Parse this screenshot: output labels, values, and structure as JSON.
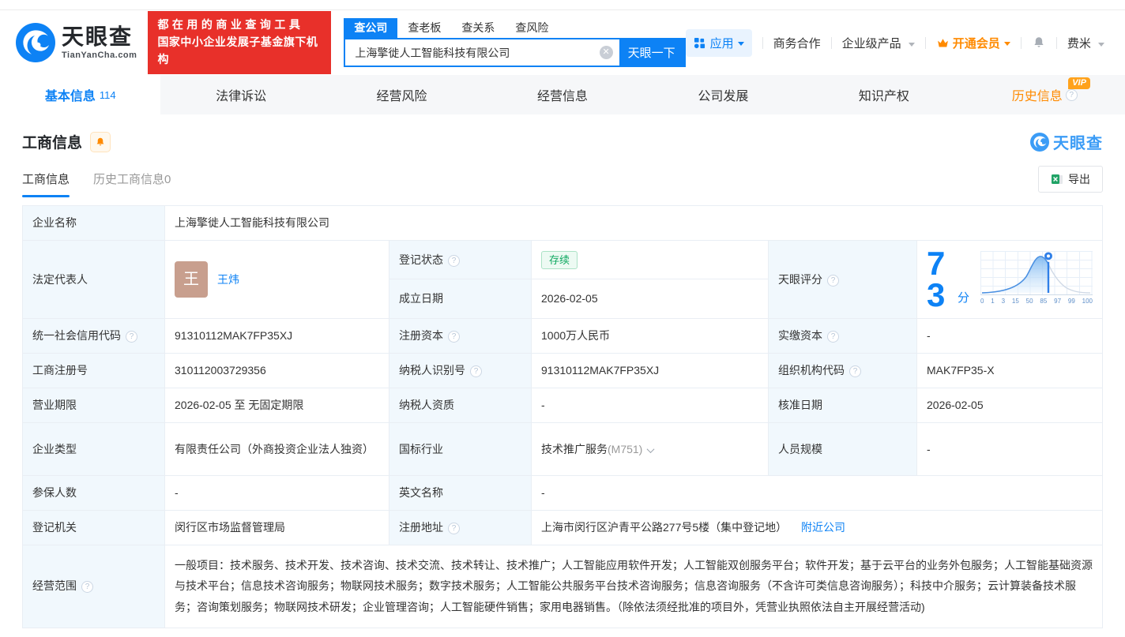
{
  "brand": {
    "name": "天眼查",
    "domain": "TianYanCha.com",
    "slogan_line1": "都在用的商业查询工具",
    "slogan_line2": "国家中小企业发展子基金旗下机构",
    "blue": "#0d82f5",
    "red": "#e8302a",
    "orange": "#ff8a00"
  },
  "search": {
    "tabs": [
      "查公司",
      "查老板",
      "查关系",
      "查风险"
    ],
    "value": "上海擎徙人工智能科技有限公司",
    "button": "天眼一下"
  },
  "top_nav": {
    "apps": "应用",
    "cooperation": "商务合作",
    "enterprise": "企业级产品",
    "vip": "开通会员",
    "user": "费米"
  },
  "main_tabs": [
    {
      "label": "基本信息",
      "count": "114",
      "active": true
    },
    {
      "label": "法律诉讼"
    },
    {
      "label": "经营风险"
    },
    {
      "label": "经营信息"
    },
    {
      "label": "公司发展"
    },
    {
      "label": "知识产权"
    },
    {
      "label": "历史信息",
      "vip_badge": "VIP"
    }
  ],
  "section": {
    "title": "工商信息"
  },
  "sub_tabs": [
    "工商信息",
    "历史工商信息0"
  ],
  "export_label": "导出",
  "score": {
    "label": "天眼评分",
    "value": "73",
    "unit": "分",
    "axis": [
      "0",
      "1",
      "3",
      "15",
      "50",
      "85",
      "97",
      "99",
      "100"
    ]
  },
  "table": {
    "company_name": {
      "label": "企业名称",
      "value": "上海擎徙人工智能科技有限公司"
    },
    "legal_rep": {
      "label": "法定代表人",
      "avatar": "王",
      "name": "王炜"
    },
    "reg_status": {
      "label": "登记状态",
      "value": "存续"
    },
    "establish_date": {
      "label": "成立日期",
      "value": "2026-02-05"
    },
    "credit_code": {
      "label": "统一社会信用代码",
      "value": "91310112MAK7FP35XJ"
    },
    "reg_capital": {
      "label": "注册资本",
      "value": "1000万人民币"
    },
    "paid_capital": {
      "label": "实缴资本",
      "value": "-"
    },
    "reg_number": {
      "label": "工商注册号",
      "value": "310112003729356"
    },
    "taxpayer_id": {
      "label": "纳税人识别号",
      "value": "91310112MAK7FP35XJ"
    },
    "org_code": {
      "label": "组织机构代码",
      "value": "MAK7FP35-X"
    },
    "business_term": {
      "label": "营业期限",
      "value": "2026-02-05 至 无固定期限"
    },
    "taxpayer_quality": {
      "label": "纳税人资质",
      "value": "-"
    },
    "approval_date": {
      "label": "核准日期",
      "value": "2026-02-05"
    },
    "company_type": {
      "label": "企业类型",
      "value": "有限责任公司（外商投资企业法人独资）"
    },
    "industry": {
      "label": "国标行业",
      "value": "技术推广服务",
      "code": "(M751)"
    },
    "staff_size": {
      "label": "人员规模",
      "value": "-"
    },
    "insured_count": {
      "label": "参保人数",
      "value": "-"
    },
    "english_name": {
      "label": "英文名称",
      "value": "-"
    },
    "reg_authority": {
      "label": "登记机关",
      "value": "闵行区市场监督管理局"
    },
    "reg_address": {
      "label": "注册地址",
      "value": "上海市闵行区沪青平公路277号5楼（集中登记地）",
      "link": "附近公司"
    },
    "business_scope": {
      "label": "经营范围",
      "value": "一般项目：技术服务、技术开发、技术咨询、技术交流、技术转让、技术推广；人工智能应用软件开发；人工智能双创服务平台；软件开发；基于云平台的业务外包服务；人工智能基础资源与技术平台；信息技术咨询服务；物联网技术服务；数字技术服务；人工智能公共服务平台技术咨询服务；信息咨询服务（不含许可类信息咨询服务）；科技中介服务；云计算装备技术服务；咨询策划服务；物联网技术研发；企业管理咨询；人工智能硬件销售；家用电器销售。（除依法须经批准的项目外，凭营业执照依法自主开展经营活动)"
    }
  }
}
